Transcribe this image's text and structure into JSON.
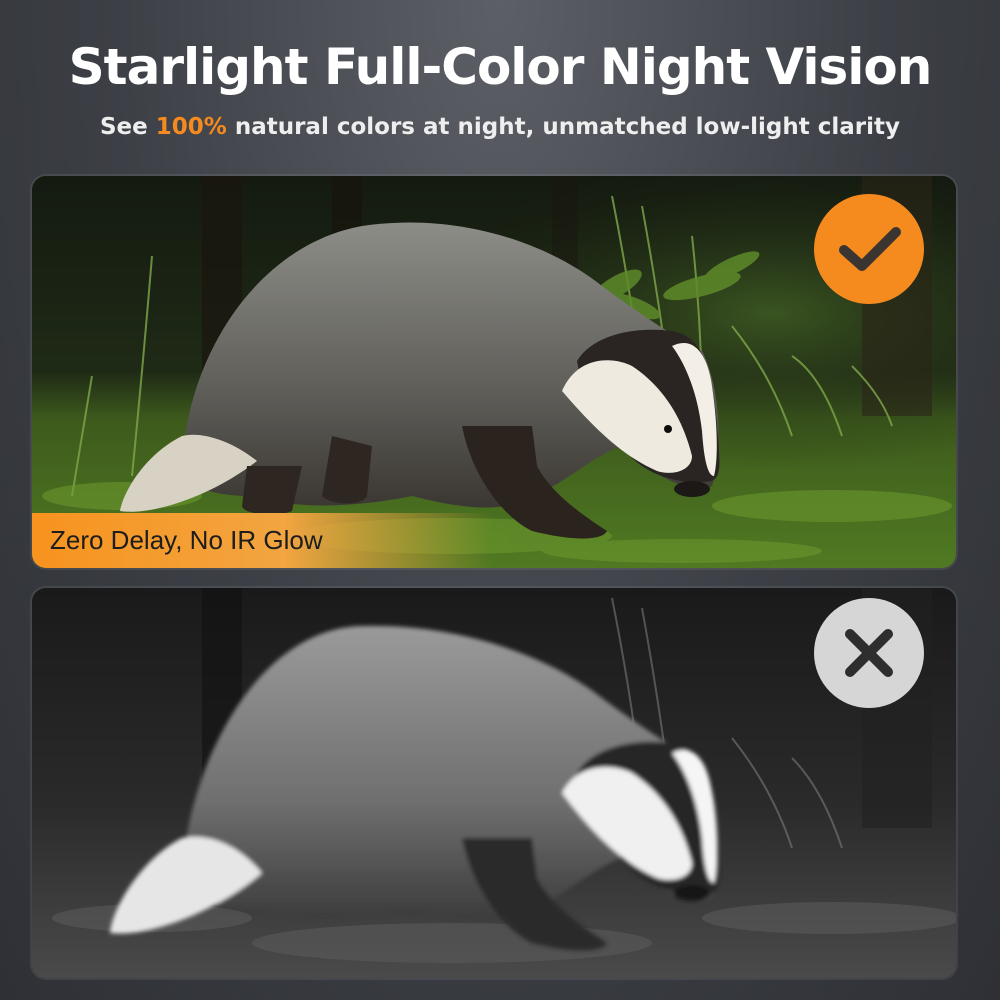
{
  "header": {
    "title": "Starlight Full-Color Night Vision",
    "subtitle_prefix": "See ",
    "subtitle_highlight": "100%",
    "subtitle_suffix": " natural colors at night, unmatched low-light clarity"
  },
  "color_panel": {
    "caption": "Zero Delay, No IR Glow",
    "badge_icon": "checkmark-icon",
    "badge_color": "#f58a1f"
  },
  "mono_panel": {
    "badge_icon": "cross-icon",
    "badge_color": "#d6d6d6"
  },
  "colors": {
    "accent": "#f58a1f",
    "background": "#3c3f45",
    "text": "#ffffff"
  }
}
